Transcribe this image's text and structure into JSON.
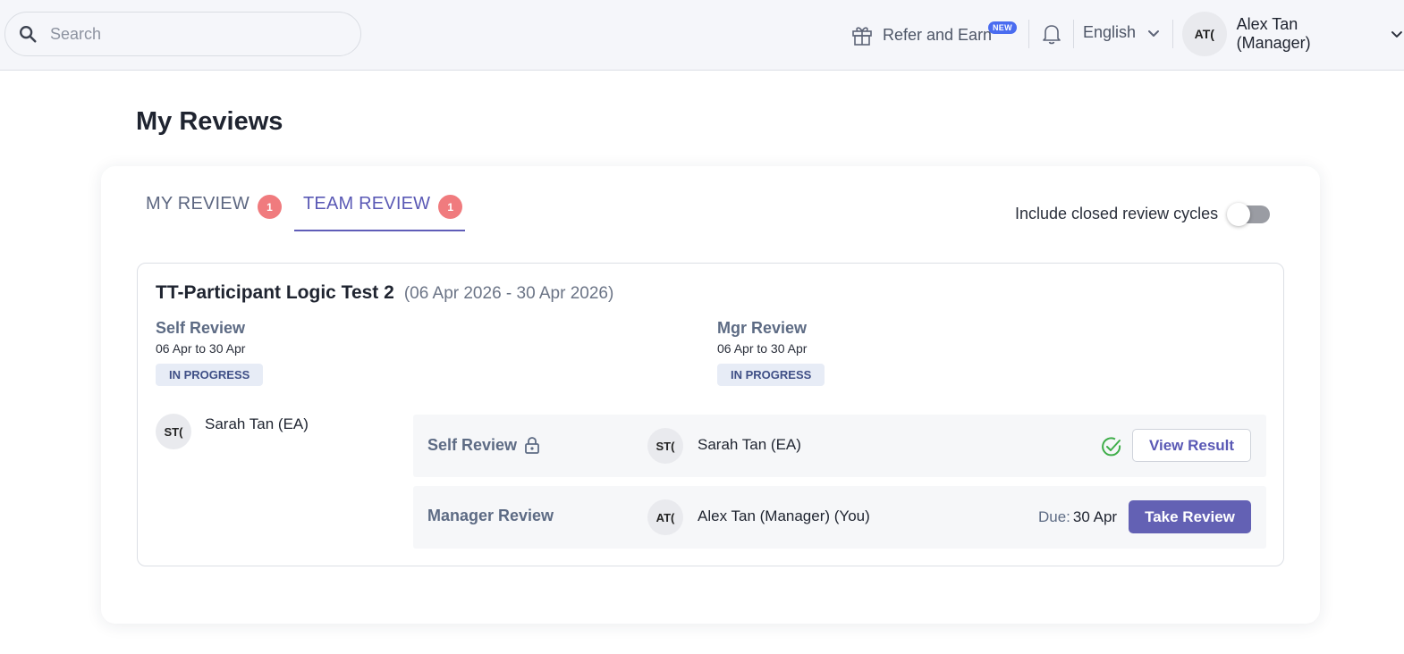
{
  "header": {
    "search_placeholder": "Search",
    "refer_label": "Refer and Earn",
    "new_badge": "NEW",
    "language": "English",
    "user_initials": "AT(",
    "user_name": "Alex Tan (Manager)"
  },
  "page": {
    "title": "My Reviews"
  },
  "tabs": [
    {
      "label": "MY REVIEW",
      "count": "1",
      "active": false
    },
    {
      "label": "TEAM REVIEW",
      "count": "1",
      "active": true
    }
  ],
  "toggle": {
    "label": "Include closed review cycles",
    "on": false
  },
  "cycle": {
    "name": "TT-Participant Logic Test 2",
    "dates": "(06 Apr 2026 - 30 Apr 2026)",
    "stages": [
      {
        "title": "Self Review",
        "range": "06 Apr to 30 Apr",
        "status": "IN PROGRESS"
      },
      {
        "title": "Mgr Review",
        "range": "06 Apr to 30 Apr",
        "status": "IN PROGRESS"
      }
    ],
    "reviewee": {
      "initials": "ST(",
      "name": "Sarah Tan (EA)"
    },
    "reviews": [
      {
        "type": "Self Review",
        "reviewer_initials": "ST(",
        "reviewer_name": "Sarah Tan (EA)",
        "action": "View Result"
      },
      {
        "type": "Manager Review",
        "reviewer_initials": "AT(",
        "reviewer_name": "Alex Tan (Manager) (You)",
        "due_label": "Due:",
        "due_value": "30 Apr",
        "action": "Take Review"
      }
    ]
  },
  "colors": {
    "accent": "#5a59b5",
    "primary_button": "#6361b4",
    "badge_red": "#f07b7e",
    "new_badge": "#4a6cf0",
    "success_green": "#3fae4a"
  },
  "icons": [
    "search-icon",
    "gift-icon",
    "bell-icon",
    "chevron-down-icon",
    "lock-icon",
    "check-circle-icon"
  ]
}
